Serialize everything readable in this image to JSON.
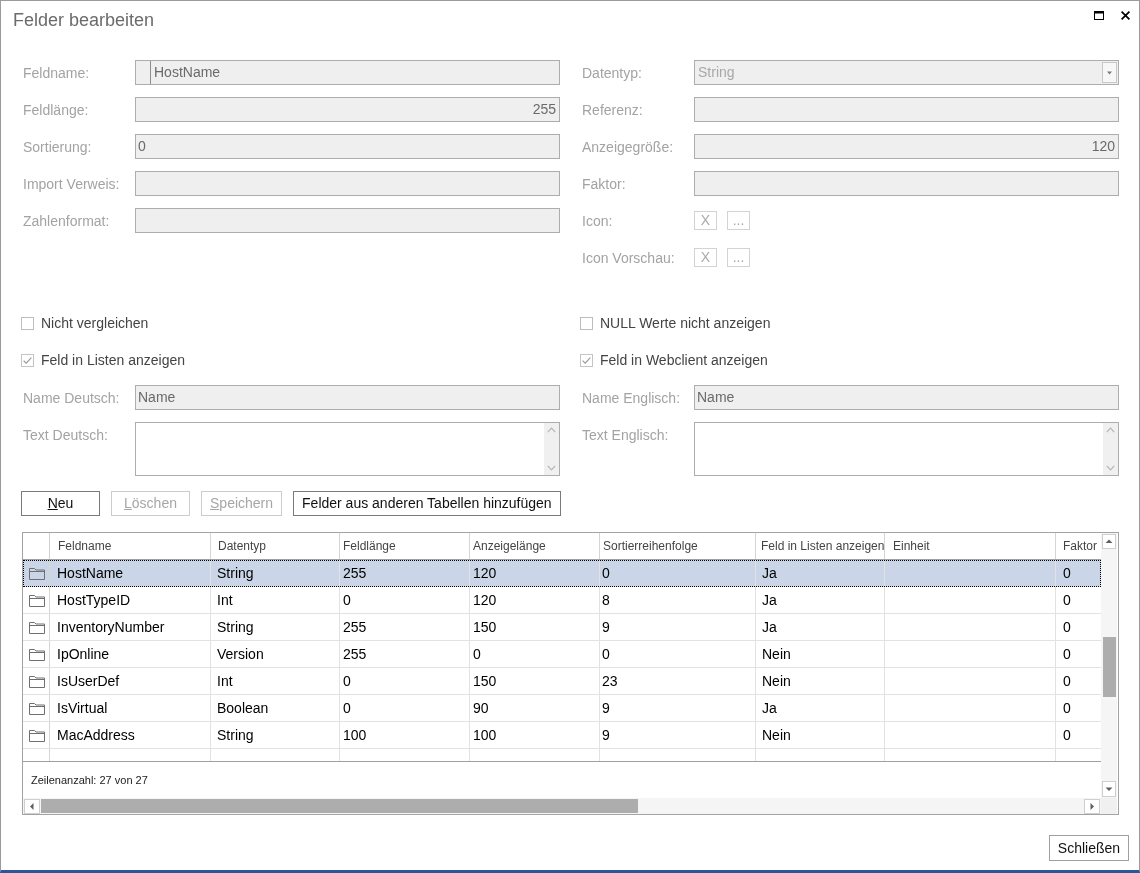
{
  "window": {
    "title": "Felder bearbeiten"
  },
  "fields_left": [
    {
      "kind": "text",
      "label": "Feldname:",
      "value": "HostName",
      "swatch": true
    },
    {
      "kind": "text",
      "label": "Feldlänge:",
      "value": "255",
      "right_aligned": true
    },
    {
      "kind": "text",
      "label": "Sortierung:",
      "value": "0"
    },
    {
      "kind": "text",
      "label": "Import Verweis:"
    },
    {
      "kind": "text",
      "label": "Zahlenformat:"
    }
  ],
  "fields_right": [
    {
      "kind": "combo",
      "label": "Datentyp:",
      "value": "String",
      "disabled": true
    },
    {
      "kind": "text",
      "label": "Referenz:"
    },
    {
      "kind": "text",
      "label": "Anzeigegröße:",
      "value": "120",
      "right_aligned": true
    },
    {
      "kind": "text",
      "label": "Faktor:"
    },
    {
      "kind": "buttons",
      "label": "Icon:",
      "buttons": [
        {
          "label": "X",
          "disabled": true
        },
        {
          "label": "...",
          "disabled": true
        }
      ]
    },
    {
      "kind": "buttons",
      "label": "Icon Vorschau:",
      "buttons": [
        {
          "label": "X",
          "disabled": true
        },
        {
          "label": "...",
          "disabled": true
        }
      ]
    }
  ],
  "options_left": [
    {
      "label": "Nicht vergleichen",
      "checked": false
    },
    {
      "label": "Feld in Listen anzeigen",
      "checked": true
    }
  ],
  "options_right": [
    {
      "label": "NULL Werte nicht anzeigen",
      "checked": false
    },
    {
      "label": "Feld in Webclient anzeigen",
      "checked": true
    }
  ],
  "names_left": [
    {
      "kind": "text",
      "label": "Name Deutsch:",
      "value": "Name"
    },
    {
      "kind": "textarea",
      "label": "Text Deutsch:"
    }
  ],
  "names_right": [
    {
      "kind": "text",
      "label": "Name Englisch:",
      "value": "Name"
    },
    {
      "kind": "textarea",
      "label": "Text Englisch:"
    }
  ],
  "action_buttons": [
    {
      "label": "Neu",
      "disabled": false,
      "mnemonic": true
    },
    {
      "label": "Löschen",
      "disabled": true,
      "mnemonic": true
    },
    {
      "label": "Speichern",
      "disabled": true,
      "mnemonic": true
    },
    {
      "label": "Felder aus anderen Tabellen hinzufügen",
      "disabled": false
    }
  ],
  "table": {
    "columns": [
      "Feldname",
      "Datentyp",
      "Feldlänge",
      "Anzeigelänge",
      "Sortierreihenfolge",
      "Feld in Listen anzeigen",
      "Einheit",
      "Faktor"
    ],
    "rows": [
      {
        "selected": true,
        "feldname": "HostName",
        "datentyp": "String",
        "feldlaenge": "255",
        "anzeigelaenge": "120",
        "sortierreihenfolge": "0",
        "in_listen": "Ja",
        "faktor": "0"
      },
      {
        "selected": false,
        "feldname": "HostTypeID",
        "datentyp": "Int",
        "feldlaenge": "0",
        "anzeigelaenge": "120",
        "sortierreihenfolge": "8",
        "in_listen": "Ja",
        "faktor": "0"
      },
      {
        "selected": false,
        "feldname": "InventoryNumber",
        "datentyp": "String",
        "feldlaenge": "255",
        "anzeigelaenge": "150",
        "sortierreihenfolge": "9",
        "in_listen": "Ja",
        "faktor": "0"
      },
      {
        "selected": false,
        "feldname": "IpOnline",
        "datentyp": "Version",
        "feldlaenge": "255",
        "anzeigelaenge": "0",
        "sortierreihenfolge": "0",
        "in_listen": "Nein",
        "faktor": "0"
      },
      {
        "selected": false,
        "feldname": "IsUserDef",
        "datentyp": "Int",
        "feldlaenge": "0",
        "anzeigelaenge": "150",
        "sortierreihenfolge": "23",
        "in_listen": "Nein",
        "faktor": "0"
      },
      {
        "selected": false,
        "feldname": "IsVirtual",
        "datentyp": "Boolean",
        "feldlaenge": "0",
        "anzeigelaenge": "90",
        "sortierreihenfolge": "9",
        "in_listen": "Ja",
        "faktor": "0"
      },
      {
        "selected": false,
        "feldname": "MacAddress",
        "datentyp": "String",
        "feldlaenge": "100",
        "anzeigelaenge": "100",
        "sortierreihenfolge": "9",
        "in_listen": "Nein",
        "faktor": "0"
      }
    ],
    "footer": "Zeilenanzahl: 27 von 27"
  },
  "close_button": {
    "label": "Schließen"
  }
}
